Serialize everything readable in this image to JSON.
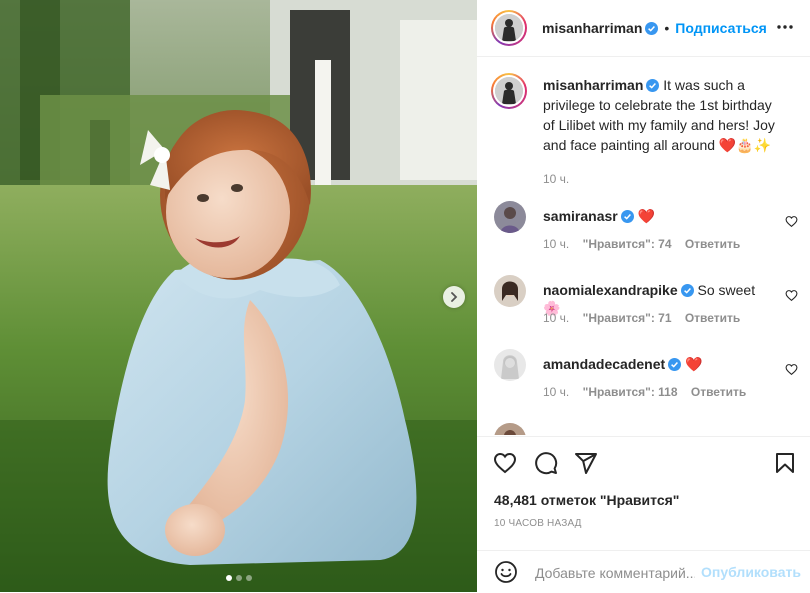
{
  "post": {
    "username": "misanharriman",
    "follow_label": "Подписаться",
    "bullet": "•",
    "caption": "It was such a privilege to celebrate the 1st birthday of Lilibet with my family and hers! Joy and face painting all around ❤️🎂✨",
    "caption_time": "10 ч.",
    "carousel_dots": 3,
    "carousel_active": 0
  },
  "comments": [
    {
      "username": "samiranasr",
      "text": "❤️",
      "time": "10 ч.",
      "likes": "\"Нравится\": 74",
      "reply": "Ответить"
    },
    {
      "username": "naomialexandrapike",
      "text": "So sweet 🌸",
      "time": "10 ч.",
      "likes": "\"Нравится\": 71",
      "reply": "Ответить"
    },
    {
      "username": "amandadecadenet",
      "text": "❤️",
      "time": "10 ч.",
      "likes": "\"Нравится\": 118",
      "reply": "Ответить"
    }
  ],
  "actions": {
    "likes_text": "48,481 отметок \"Нравится\"",
    "date_text": "10 ЧАСОВ НАЗАД"
  },
  "add_comment": {
    "placeholder": "Добавьте комментарий...",
    "post_label": "Опубликовать"
  },
  "icons": [
    "heart-icon",
    "comment-icon",
    "share-icon",
    "bookmark-icon",
    "emoji-icon",
    "more-icon",
    "verified-icon",
    "chevron-right-icon"
  ],
  "colors": {
    "accent": "#0095f6",
    "post_disabled": "#b2dffc",
    "heart_red": "#c0001a",
    "verified": "#3897f0"
  }
}
